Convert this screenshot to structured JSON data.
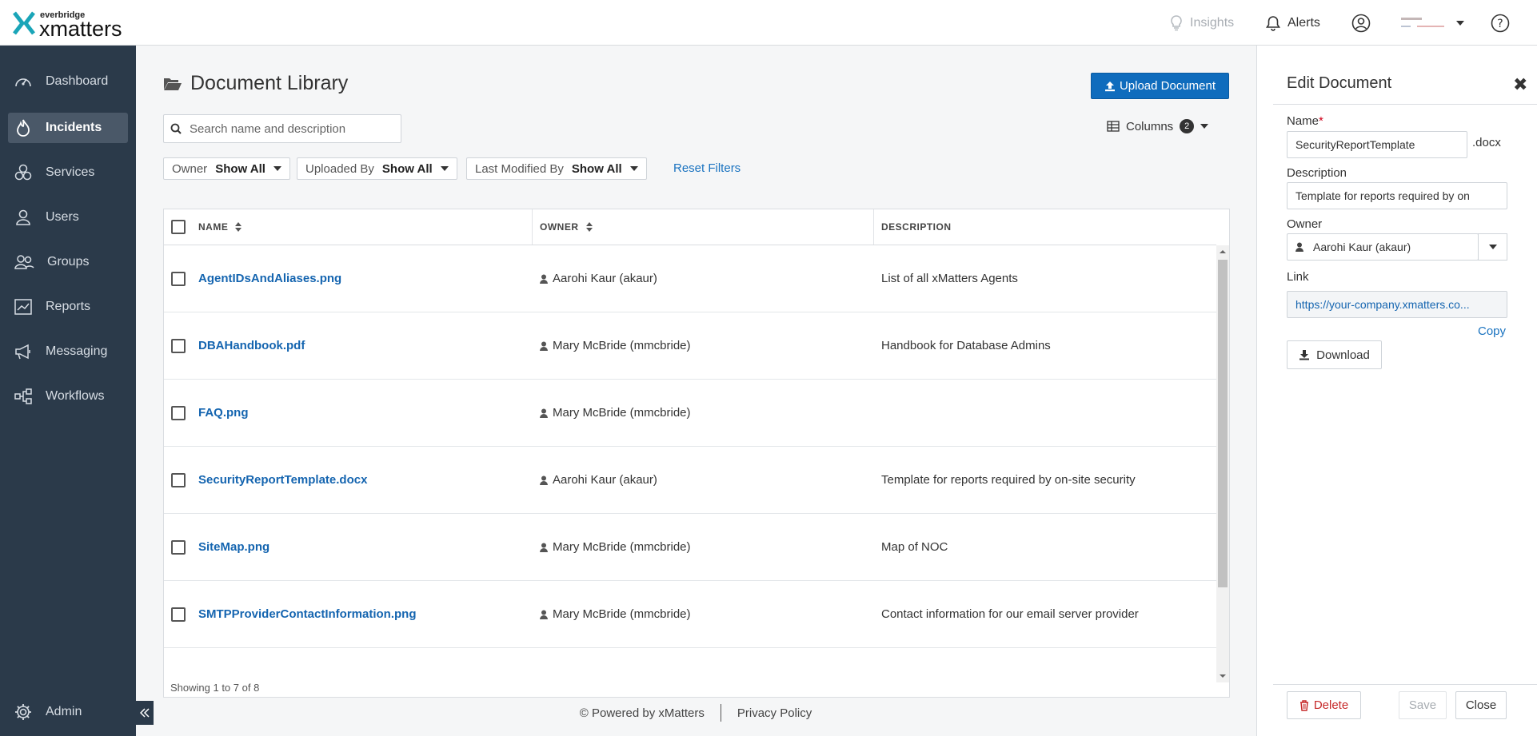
{
  "app": {
    "brand_small": "everbridge",
    "brand_name": "xmatters",
    "accent_color": "#0f6cbd",
    "sidebar_color": "#2b3a4a"
  },
  "topbar": {
    "insights_label": "Insights",
    "alerts_label": "Alerts",
    "help_icon": "question-circle-icon",
    "user_icon": "user-circle-icon"
  },
  "sidebar": {
    "items": [
      {
        "label": "Dashboard",
        "icon": "speedometer-icon",
        "active": false
      },
      {
        "label": "Incidents",
        "icon": "flame-icon",
        "active": true
      },
      {
        "label": "Services",
        "icon": "services-icon",
        "active": false
      },
      {
        "label": "Users",
        "icon": "user-icon",
        "active": false
      },
      {
        "label": "Groups",
        "icon": "group-icon",
        "active": false
      },
      {
        "label": "Reports",
        "icon": "chart-icon",
        "active": false
      },
      {
        "label": "Messaging",
        "icon": "megaphone-icon",
        "active": false
      },
      {
        "label": "Workflows",
        "icon": "workflow-icon",
        "active": false
      }
    ],
    "admin_label": "Admin"
  },
  "main": {
    "title": "Document Library",
    "upload_label": "Upload Document",
    "search_placeholder": "Search name and description",
    "columns_label": "Columns",
    "columns_count": "2",
    "filters": [
      {
        "label": "Owner",
        "value": "Show All"
      },
      {
        "label": "Uploaded By",
        "value": "Show All"
      },
      {
        "label": "Last Modified By",
        "value": "Show All"
      }
    ],
    "reset_label": "Reset Filters",
    "table": {
      "headers": {
        "name": "NAME",
        "owner": "OWNER",
        "description": "DESCRIPTION"
      },
      "rows": [
        {
          "name": "AgentIDsAndAliases.png",
          "owner": "Aarohi Kaur (akaur)",
          "description": "List of all xMatters Agents"
        },
        {
          "name": "DBAHandbook.pdf",
          "owner": "Mary McBride (mmcbride)",
          "description": "Handbook for Database Admins"
        },
        {
          "name": "FAQ.png",
          "owner": "Mary McBride (mmcbride)",
          "description": ""
        },
        {
          "name": "SecurityReportTemplate.docx",
          "owner": "Aarohi Kaur (akaur)",
          "description": "Template for reports required by on-site security"
        },
        {
          "name": "SiteMap.png",
          "owner": "Mary McBride (mmcbride)",
          "description": "Map of NOC"
        },
        {
          "name": "SMTPProviderContactInformation.png",
          "owner": "Mary McBride (mmcbride)",
          "description": "Contact information for our email server provider"
        }
      ],
      "showing": "Showing 1 to 7 of 8"
    },
    "footer": {
      "powered": "© Powered by xMatters",
      "privacy": "Privacy Policy"
    }
  },
  "panel": {
    "title": "Edit Document",
    "name_label": "Name",
    "name_required": "*",
    "name_value": "SecurityReportTemplate",
    "extension": ".docx",
    "description_label": "Description",
    "description_value": "Template for reports required by on",
    "owner_label": "Owner",
    "owner_value": "Aarohi Kaur (akaur)",
    "link_label": "Link",
    "link_value": "https://your-company.xmatters.co...",
    "copy_label": "Copy",
    "download_label": "Download",
    "delete_label": "Delete",
    "save_label": "Save",
    "close_label": "Close"
  }
}
